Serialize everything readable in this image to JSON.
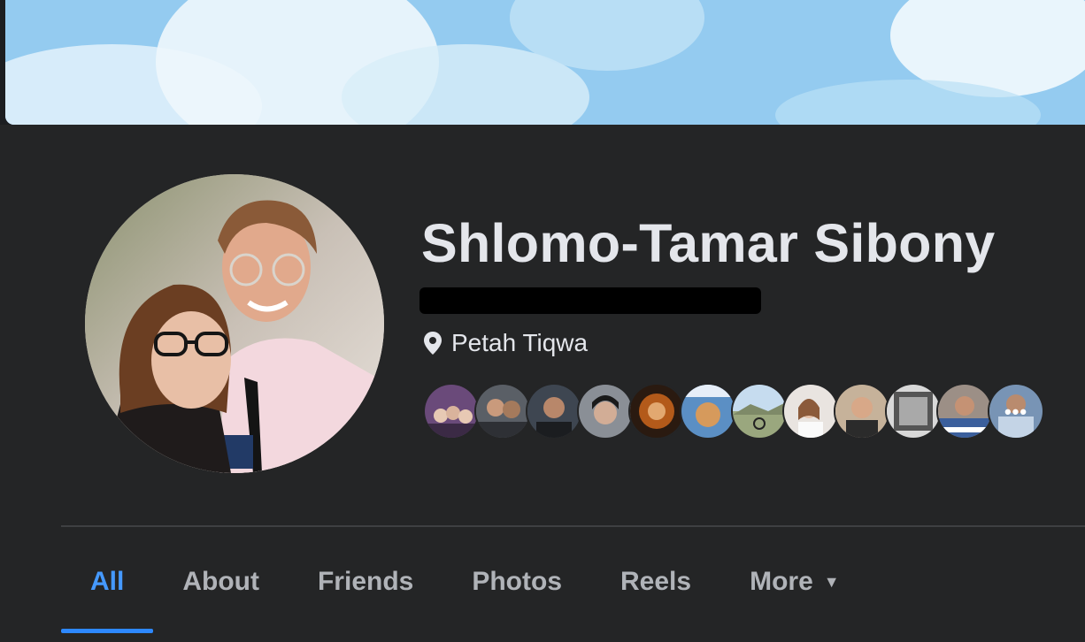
{
  "profile": {
    "name": "Shlomo-Tamar Sibony",
    "location": "Petah Tiqwa",
    "location_icon": "map-pin-icon"
  },
  "friends_preview": {
    "count_shown": 12,
    "more_indicator": "•••",
    "colors": [
      "#6a4a7a",
      "#5a5f66",
      "#3e4651",
      "#8a8f96",
      "#b35a1a",
      "#5b8fc4",
      "#9aa77e",
      "#e9e4e0",
      "#c6b29a",
      "#d8d8d8",
      "#3b5f9c",
      "#7894b5"
    ]
  },
  "tabs": [
    {
      "label": "All",
      "active": true
    },
    {
      "label": "About",
      "active": false
    },
    {
      "label": "Friends",
      "active": false
    },
    {
      "label": "Photos",
      "active": false
    },
    {
      "label": "Reels",
      "active": false
    },
    {
      "label": "More",
      "active": false,
      "icon": "caret-down-icon"
    }
  ],
  "colors": {
    "background": "#242526",
    "text_primary": "#e4e6eb",
    "text_secondary": "#b0b3b8",
    "accent": "#2d88ff"
  }
}
